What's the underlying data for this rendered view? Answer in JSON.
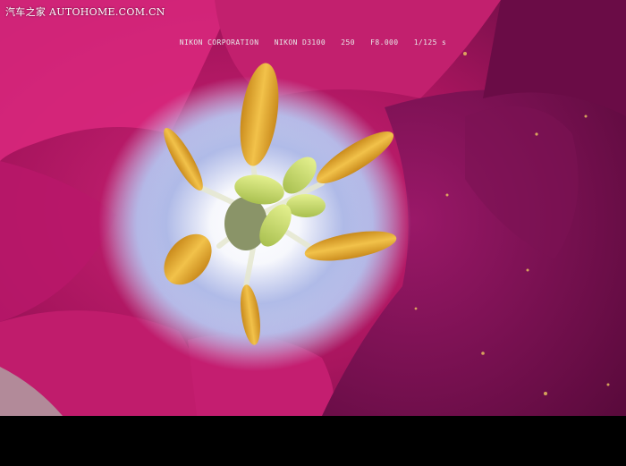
{
  "watermark": {
    "site_cn": "汽车之家",
    "site_en": "AUTOHOME.COM.CN"
  },
  "exif": {
    "maker": "NIKON CORPORATION",
    "model": "NIKON D3100",
    "iso": "250",
    "aperture": "F8.000",
    "shutter": "1/125 s"
  },
  "colors": {
    "petal_magenta": "#c81e6e",
    "petal_purple": "#7a1050",
    "center_white": "#f4f0f6",
    "center_blue": "#8da0e0",
    "anther_yellow": "#e8b030",
    "stigma_green": "#c8dc70"
  }
}
